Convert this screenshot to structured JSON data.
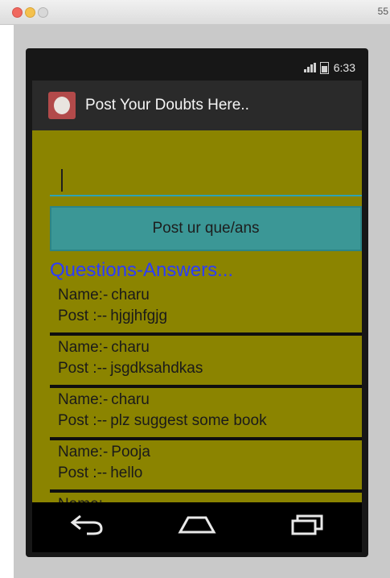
{
  "window": {
    "title": "55"
  },
  "status_bar": {
    "time": "6:33"
  },
  "action_bar": {
    "title": "Post Your Doubts Here.."
  },
  "form": {
    "input_value": "",
    "input_placeholder": "",
    "button_label": "Post ur que/ans"
  },
  "list": {
    "heading": "Questions-Answers...",
    "items": [
      {
        "name_label": "Name:-",
        "name": "charu",
        "post_label": "Post :--",
        "post": "hjgjhfgjg"
      },
      {
        "name_label": "Name:-",
        "name": "charu",
        "post_label": "Post :--",
        "post": "jsgdksahdkas"
      },
      {
        "name_label": "Name:-",
        "name": "charu",
        "post_label": "Post :--",
        "post": "plz suggest some book"
      },
      {
        "name_label": "Name:-",
        "name": "Pooja",
        "post_label": "Post :--",
        "post": "hello"
      },
      {
        "name_label": "Name:-",
        "name": "",
        "post_label": "",
        "post": ""
      }
    ]
  },
  "nav": {
    "back_icon": "back-icon",
    "home_icon": "home-icon",
    "recents_icon": "recents-icon"
  },
  "colors": {
    "content_bg": "#8b8400",
    "button_bg": "#3b9796",
    "heading": "#2b3cff",
    "action_bar": "#2a2a2a"
  }
}
